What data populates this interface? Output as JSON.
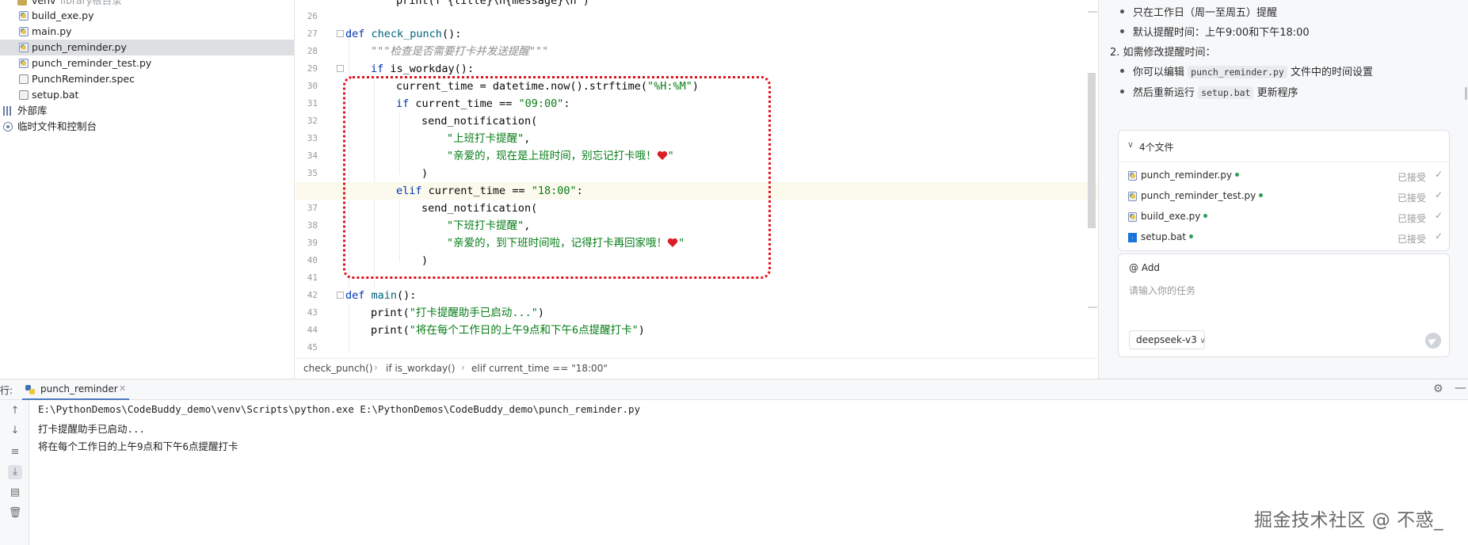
{
  "project_tree": {
    "items": [
      {
        "label": "venv",
        "hint": "library根目录",
        "icon": "folder-icon"
      },
      {
        "label": "build_exe.py",
        "icon": "python-file-icon"
      },
      {
        "label": "main.py",
        "icon": "python-file-icon"
      },
      {
        "label": "punch_reminder.py",
        "icon": "python-file-icon",
        "selected": true
      },
      {
        "label": "punch_reminder_test.py",
        "icon": "python-file-icon"
      },
      {
        "label": "PunchReminder.spec",
        "icon": "spec-file-icon"
      },
      {
        "label": "setup.bat",
        "icon": "bat-file-icon"
      },
      {
        "label": "外部库",
        "icon": "library-icon"
      },
      {
        "label": "临时文件和控制台",
        "icon": "scratch-icon"
      }
    ]
  },
  "editor": {
    "line_numbers": [
      "26",
      "27",
      "28",
      "29",
      "30",
      "31",
      "32",
      "33",
      "34",
      "35",
      "36",
      "37",
      "38",
      "39",
      "40",
      "41",
      "42",
      "43",
      "44",
      "45"
    ],
    "code": {
      "top": "print(f\"{title}\\n{message}\\n\")",
      "l27_kw": "def",
      "l27_fn": "check_punch",
      "l27_rest": "():",
      "l28": "\"\"\"检查是否需要打卡并发送提醒\"\"\"",
      "l29_kw": "if",
      "l29_rest": "is_workday():",
      "l30_a": "current_time = datetime.now().strftime(",
      "l30_str": "\"%H:%M\"",
      "l30_b": ")",
      "l31_kw": "if",
      "l31_a": "current_time ==",
      "l31_str": "\"09:00\"",
      "l31_b": ":",
      "l32": "send_notification(",
      "l33": "\"上班打卡提醒\"",
      "l33_comma": ",",
      "l34_str": "\"亲爱的，现在是上班时间，别忘记打卡哦！",
      "l34_end": "\"",
      "l35": ")",
      "l36_kw": "elif",
      "l36_a": "current_time ==",
      "l36_str": "\"18:00\"",
      "l36_b": ":",
      "l37": "send_notification(",
      "l38": "\"下班打卡提醒\"",
      "l38_comma": ",",
      "l39_str": "\"亲爱的，到下班时间啦，记得打卡再回家哦！",
      "l39_end": "\"",
      "l40": ")",
      "l42_kw": "def",
      "l42_fn": "main",
      "l42_rest": "():",
      "l43_a": "print(",
      "l43_str": "\"打卡提醒助手已启动...\"",
      "l43_b": ")",
      "l44_a": "print(",
      "l44_str": "\"将在每个工作日的上午9点和下午6点提醒打卡\"",
      "l44_b": ")"
    },
    "breadcrumb": [
      "check_punch()",
      "if is_workday()",
      "elif current_time == \"18:00\""
    ]
  },
  "ai_panel": {
    "bullets_top": [
      "只在工作日（周一至周五）提醒",
      "默认提醒时间：上午9:00和下午18:00"
    ],
    "numbered": "2. 如需修改提醒时间：",
    "bullet3_pre": "你可以编辑",
    "bullet3_code": "punch_reminder.py",
    "bullet3_post": "文件中的时间设置",
    "bullet4_pre": "然后重新运行",
    "bullet4_code": "setup.bat",
    "bullet4_post": "更新程序",
    "files_title": "4个文件",
    "files": [
      {
        "name": "punch_reminder.py",
        "status": "已接受",
        "icon": "python-file-icon"
      },
      {
        "name": "punch_reminder_test.py",
        "status": "已接受",
        "icon": "python-file-icon"
      },
      {
        "name": "build_exe.py",
        "status": "已接受",
        "icon": "python-file-icon"
      },
      {
        "name": "setup.bat",
        "status": "已接受",
        "icon": "windows-icon"
      }
    ],
    "add_label": "@ Add",
    "input_placeholder": "请输入你的任务",
    "model": "deepseek-v3"
  },
  "run_panel": {
    "label": "行:",
    "tab": "punch_reminder",
    "console": [
      "E:\\PythonDemos\\CodeBuddy_demo\\venv\\Scripts\\python.exe E:\\PythonDemos\\CodeBuddy_demo\\punch_reminder.py",
      "打卡提醒助手已启动...",
      "将在每个工作日的上午9点和下午6点提醒打卡"
    ]
  },
  "watermark": "掘金技术社区 @ 不惑_",
  "colors": {
    "keyword": "#0033b3",
    "string": "#067d17",
    "highlight_box": "#e0121b",
    "accepted_dot": "#2e9d5b"
  }
}
